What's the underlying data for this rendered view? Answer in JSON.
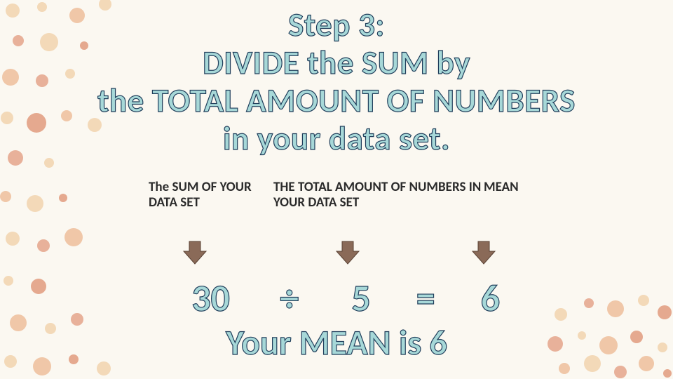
{
  "title": {
    "line1": "Step 3:",
    "line2": "DIVIDE the SUM by",
    "line3": "the TOTAL AMOUNT OF NUMBERS",
    "line4": "in your data set."
  },
  "labels": {
    "sum": "The SUM OF YOUR DATA SET",
    "total": "THE TOTAL AMOUNT OF NUMBERS IN YOUR DATA SET",
    "mean": "MEAN"
  },
  "equation": {
    "val1": "30",
    "op1": "÷",
    "val2": "5",
    "op2": "=",
    "result": "6"
  },
  "conclusion": "Your MEAN is 6",
  "colors": {
    "Q": "#f3d9b8",
    "R": "#e8b19a",
    "S": "#f0c7a8",
    "T": "#e5a98f"
  }
}
